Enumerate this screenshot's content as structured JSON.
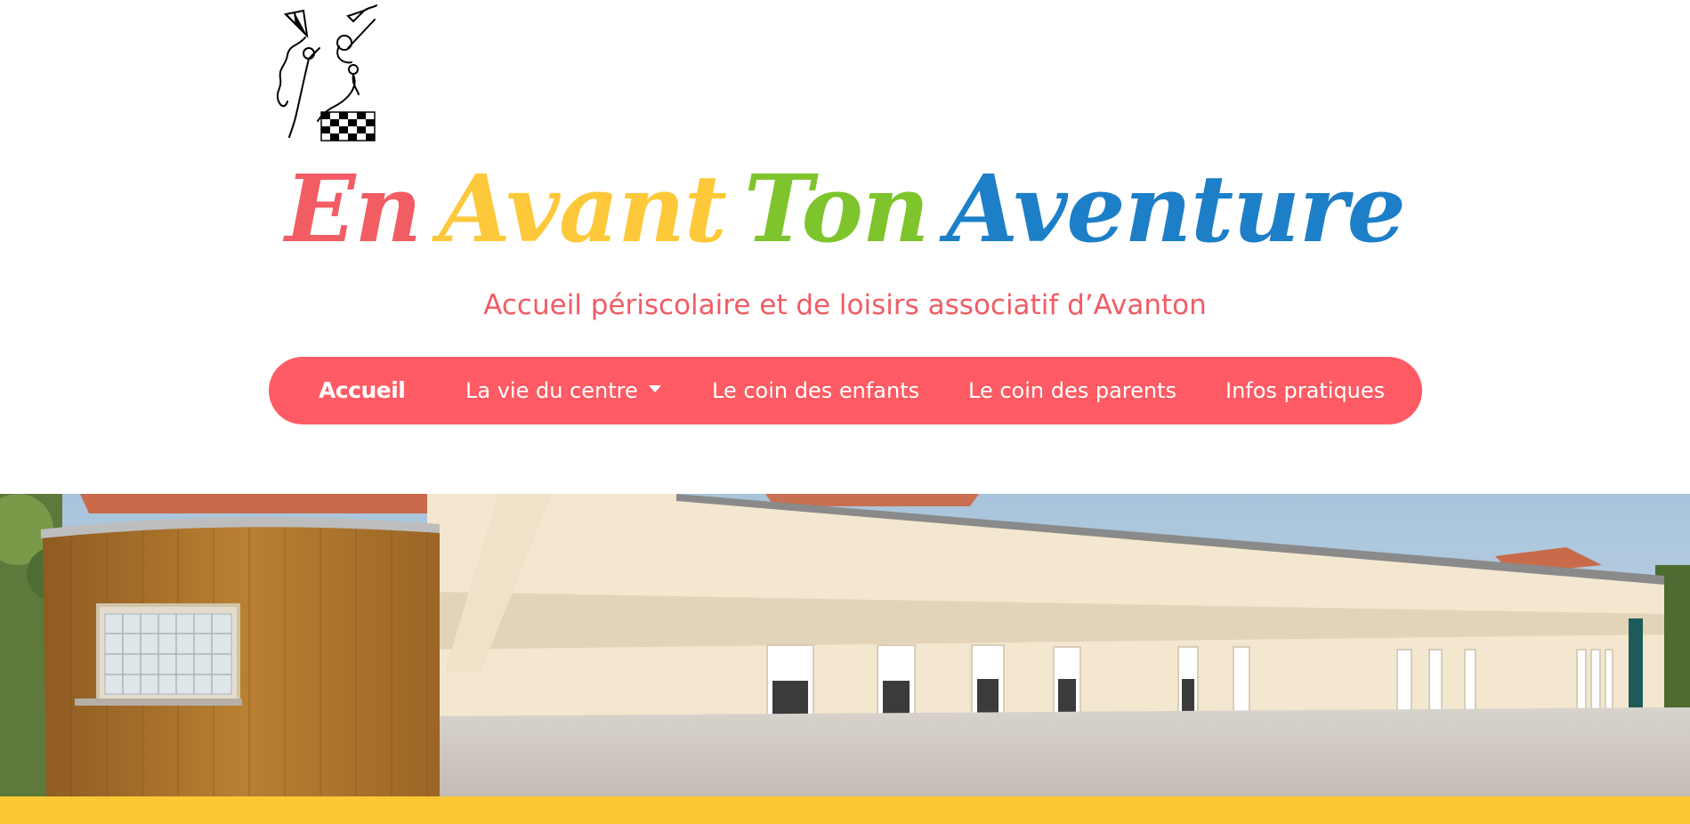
{
  "header": {
    "logo_icon": "kite-child-checkered-flag-logo",
    "title_words": [
      {
        "text": "En",
        "color": "#f25c63"
      },
      {
        "text": "Avant",
        "color": "#fdc93a"
      },
      {
        "text": "Ton",
        "color": "#7ec42c"
      },
      {
        "text": "Aventure",
        "color": "#1c7fc7"
      }
    ],
    "tagline": "Accueil périscolaire et de loisirs associatif d’Avanton"
  },
  "nav": {
    "background": "#fe5b64",
    "items": [
      {
        "label": "Accueil",
        "active": true
      },
      {
        "label": "La vie du centre",
        "dropdown": true,
        "caret_icon": "caret-down-icon"
      },
      {
        "label": "Le coin des enfants"
      },
      {
        "label": "Le coin des parents"
      },
      {
        "label": "Infos pratiques"
      }
    ]
  },
  "hero": {
    "image": "school-building-photo"
  },
  "footer_band": {
    "color": "#fec835"
  }
}
